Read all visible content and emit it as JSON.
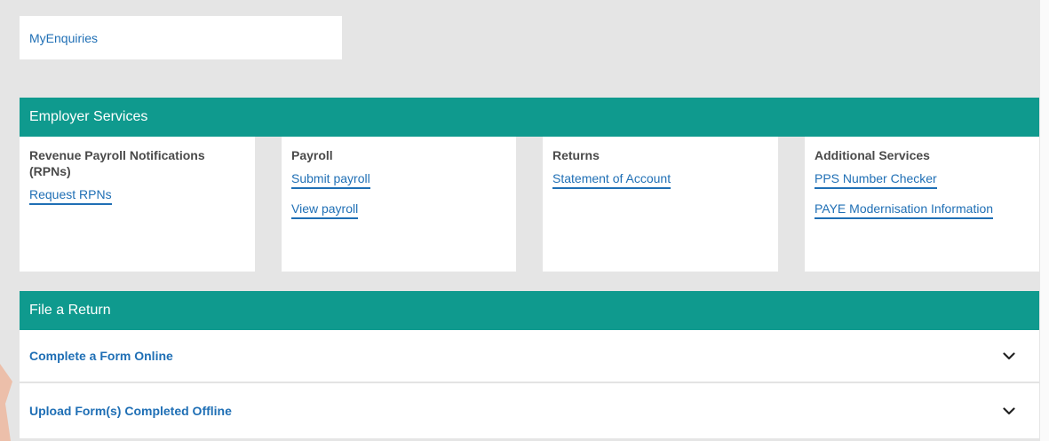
{
  "top_card": {
    "link_label": "MyEnquiries"
  },
  "employer_services": {
    "header": "Employer Services",
    "columns": [
      {
        "title": "Revenue Payroll Notifications (RPNs)",
        "links": [
          "Request RPNs"
        ]
      },
      {
        "title": "Payroll",
        "links": [
          "Submit payroll",
          "View payroll"
        ]
      },
      {
        "title": "Returns",
        "links": [
          "Statement of Account"
        ]
      },
      {
        "title": "Additional Services",
        "links": [
          "PPS Number Checker",
          "PAYE Modernisation Information"
        ]
      }
    ]
  },
  "file_a_return": {
    "header": "File a Return",
    "items": [
      {
        "label": "Complete a Form Online",
        "icon": "chevron-down-icon"
      },
      {
        "label": "Upload Form(s) Completed Offline",
        "icon": "chevron-down-icon"
      }
    ]
  },
  "colors": {
    "teal_header": "#0f9a8e",
    "link_blue": "#1f6fb5",
    "background": "#e5e5e5",
    "card": "#ffffff",
    "title_gray": "#4a4a4a"
  }
}
